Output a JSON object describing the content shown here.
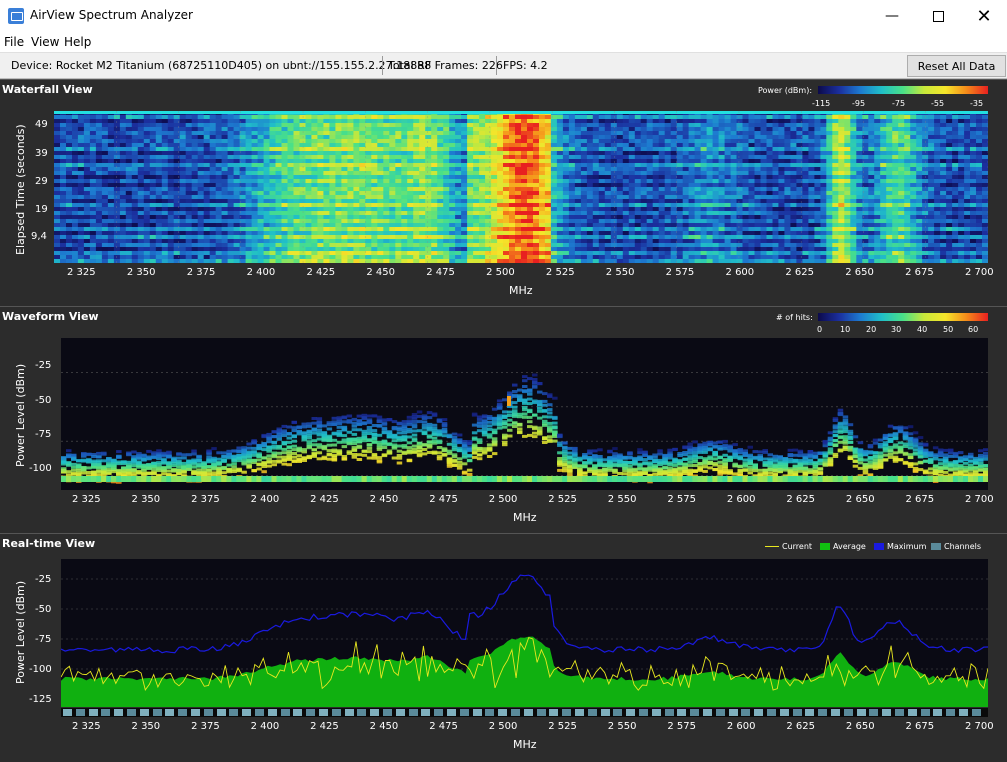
{
  "window": {
    "title": "AirView Spectrum Analyzer",
    "icon": "app-icon",
    "controls": [
      "minimize",
      "maximize",
      "close"
    ]
  },
  "menu": [
    "File",
    "View",
    "Help"
  ],
  "status": {
    "device": "Device: Rocket M2 Titanium (68725110D405) on ubnt://155.155.2.27:18888",
    "frames": "Total RF Frames: 226",
    "fps": "FPS: 4.2",
    "reset_label": "Reset All Data"
  },
  "waterfall": {
    "title": "Waterfall View",
    "legend_label": "Power (dBm):",
    "legend_ticks": [
      "-115",
      "-95",
      "-75",
      "-55",
      "-35"
    ],
    "ylabel": "Elapsed Time (seconds)",
    "yticks": [
      "49",
      "39",
      "29",
      "19",
      "9,4"
    ],
    "xlabel": "MHz"
  },
  "waveform": {
    "title": "Waveform View",
    "legend_label": "# of hits:",
    "legend_ticks": [
      "0",
      "10",
      "20",
      "30",
      "40",
      "50",
      "60"
    ],
    "ylabel": "Power Level (dBm)",
    "yticks": [
      "-25",
      "-50",
      "-75",
      "-100"
    ],
    "xlabel": "MHz"
  },
  "realtime": {
    "title": "Real-time View",
    "ylabel": "Power Level (dBm)",
    "yticks": [
      "-25",
      "-50",
      "-75",
      "-100",
      "-125"
    ],
    "xlabel": "MHz",
    "legend": [
      {
        "label": "Current",
        "color": "#e8e820"
      },
      {
        "label": "Average",
        "color": "#10c010"
      },
      {
        "label": "Maximum",
        "color": "#1a1adf"
      },
      {
        "label": "Channels",
        "color": "#5a8a9a"
      }
    ]
  },
  "xticks": [
    "2 325",
    "2 350",
    "2 375",
    "2 400",
    "2 425",
    "2 450",
    "2 475",
    "2 500",
    "2 525",
    "2 550",
    "2 575",
    "2 600",
    "2 625",
    "2 650",
    "2 675",
    "2 700"
  ]
}
